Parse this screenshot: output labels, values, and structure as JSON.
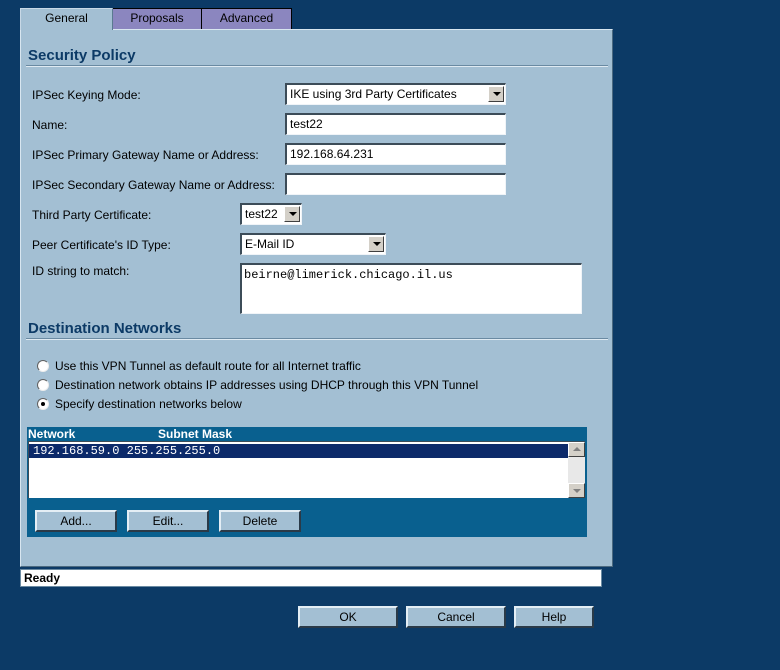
{
  "tabs": [
    {
      "label": "General",
      "active": true
    },
    {
      "label": "Proposals",
      "active": false
    },
    {
      "label": "Advanced",
      "active": false
    }
  ],
  "security_policy": {
    "title": "Security Policy",
    "ipsec_keying_mode": {
      "label": "IPSec Keying Mode:",
      "value": "IKE using 3rd Party Certificates"
    },
    "name": {
      "label": "Name:",
      "value": "test22"
    },
    "primary_gateway": {
      "label": "IPSec Primary Gateway Name or Address:",
      "value": "192.168.64.231"
    },
    "secondary_gateway": {
      "label": "IPSec Secondary Gateway Name or Address:",
      "value": ""
    },
    "third_party_cert": {
      "label": "Third Party Certificate:",
      "value": "test22"
    },
    "peer_id_type": {
      "label": "Peer Certificate's ID Type:",
      "value": "E-Mail ID"
    },
    "id_string": {
      "label": "ID string to match:",
      "value": "beirne@limerick.chicago.il.us"
    }
  },
  "destination_networks": {
    "title": "Destination Networks",
    "options": [
      {
        "label": "Use this VPN Tunnel as default route for all Internet traffic",
        "checked": false
      },
      {
        "label": "Destination network obtains IP addresses using DHCP through this VPN Tunnel",
        "checked": false
      },
      {
        "label": "Specify destination networks below",
        "checked": true
      }
    ],
    "columns": [
      "Network",
      "Subnet Mask"
    ],
    "rows": [
      {
        "text": "192.168.59.0 255.255.255.0",
        "selected": true
      }
    ],
    "buttons": {
      "add": "Add...",
      "edit": "Edit...",
      "delete": "Delete"
    }
  },
  "status": "Ready",
  "dialog_buttons": {
    "ok": "OK",
    "cancel": "Cancel",
    "help": "Help"
  },
  "colors": {
    "background": "#0c3a66",
    "panel": "#a3bfd3",
    "tab_inactive": "#8b86bf",
    "section_title": "#0c3a66",
    "net_header": "#09608f"
  }
}
